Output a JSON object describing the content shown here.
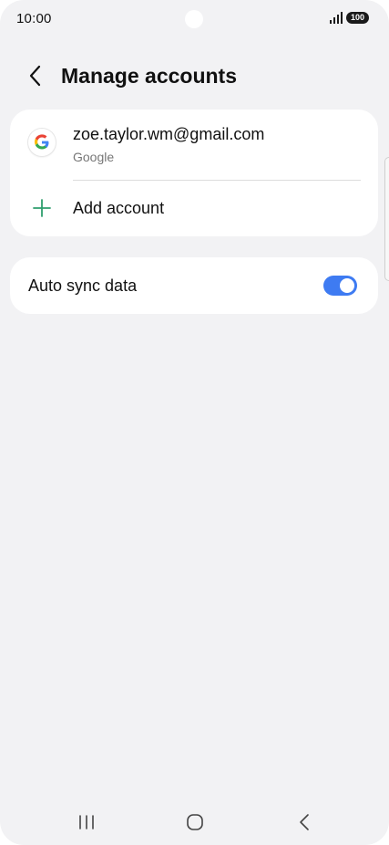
{
  "status_bar": {
    "time": "10:00",
    "battery": "100",
    "icons": [
      "signal-icon",
      "battery-icon"
    ]
  },
  "header": {
    "title": "Manage accounts",
    "back_icon": "chevron-left-icon"
  },
  "accounts": [
    {
      "email": "zoe.taylor.wm@gmail.com",
      "provider": "Google",
      "icon": "google-logo-icon"
    }
  ],
  "add_account": {
    "label": "Add account",
    "icon": "plus-icon"
  },
  "auto_sync": {
    "label": "Auto sync data",
    "enabled": true
  },
  "nav_bar": {
    "icons": [
      "recents-icon",
      "home-icon",
      "back-icon"
    ]
  },
  "colors": {
    "background": "#f2f2f4",
    "card": "#ffffff",
    "toggle_on": "#3e7bf2",
    "plus_accent": "#2f9e6e",
    "secondary_text": "#777777"
  }
}
